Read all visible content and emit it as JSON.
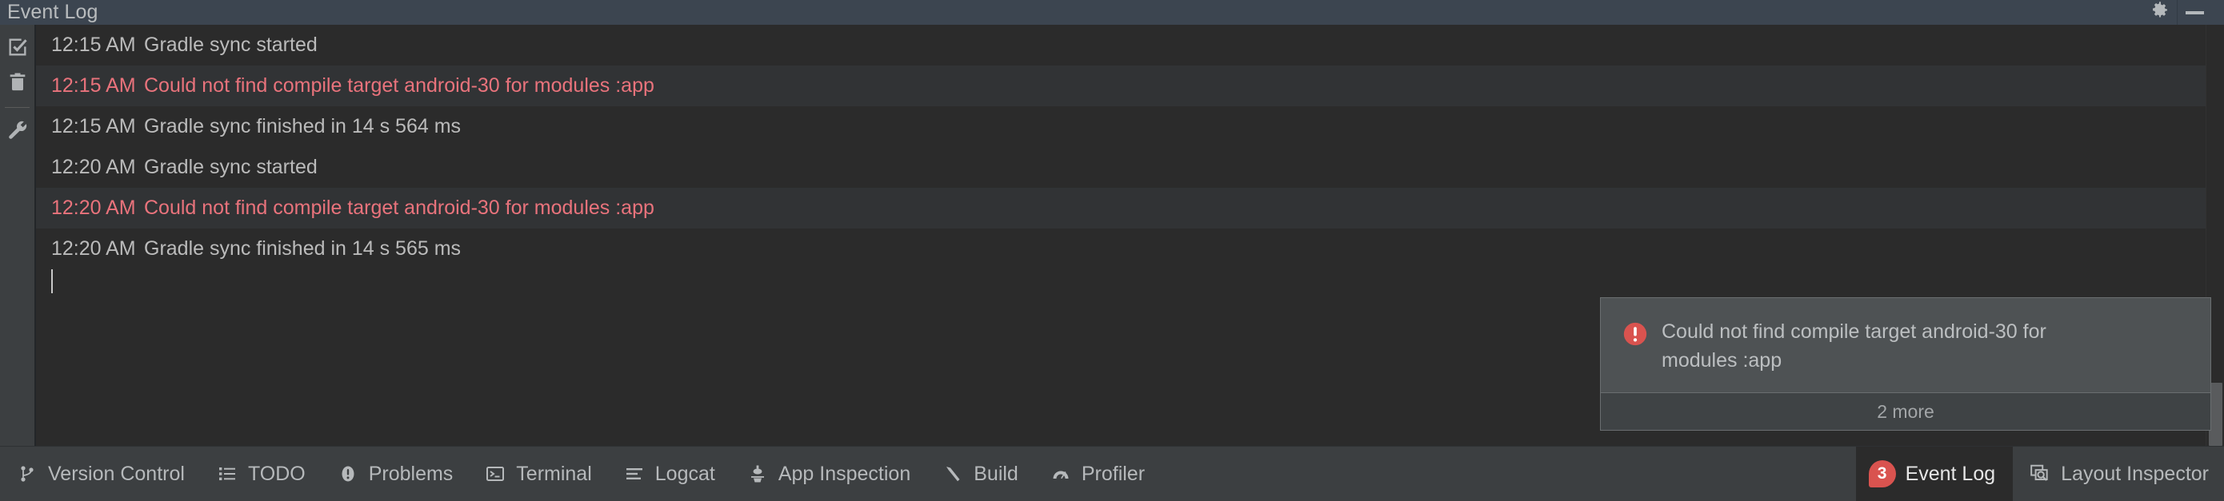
{
  "window": {
    "title": "Event Log",
    "settings_icon": "gear-icon",
    "minimize_icon": "minimize-icon"
  },
  "toolstrip": {
    "items": [
      {
        "icon": "checkbox-checked-icon",
        "label": "Mark all as read"
      },
      {
        "icon": "trash-icon",
        "label": "Clear all"
      },
      {
        "icon": "wrench-icon",
        "label": "Settings"
      }
    ]
  },
  "log": {
    "entries": [
      {
        "time": "12:15 AM",
        "message": "Gradle sync started",
        "level": "info"
      },
      {
        "time": "12:15 AM",
        "message": "Could not find compile target android-30 for modules :app",
        "level": "error"
      },
      {
        "time": "12:15 AM",
        "message": "Gradle sync finished in 14 s 564 ms",
        "level": "info"
      },
      {
        "time": "12:20 AM",
        "message": "Gradle sync started",
        "level": "info"
      },
      {
        "time": "12:20 AM",
        "message": "Could not find compile target android-30 for modules :app",
        "level": "error"
      },
      {
        "time": "12:20 AM",
        "message": "Gradle sync finished in 14 s 565 ms",
        "level": "info"
      }
    ]
  },
  "notification": {
    "icon": "error-circle-icon",
    "message": "Could not find compile target android-30 for modules :app",
    "more_label": "2 more"
  },
  "statusbar": {
    "left_items": [
      {
        "icon": "version-control-icon",
        "label": "Version Control"
      },
      {
        "icon": "todo-list-icon",
        "label": "TODO"
      },
      {
        "icon": "problems-icon",
        "label": "Problems"
      },
      {
        "icon": "terminal-icon",
        "label": "Terminal"
      },
      {
        "icon": "logcat-icon",
        "label": "Logcat"
      },
      {
        "icon": "app-inspection-icon",
        "label": "App Inspection"
      },
      {
        "icon": "build-hammer-icon",
        "label": "Build"
      },
      {
        "icon": "profiler-icon",
        "label": "Profiler"
      }
    ],
    "right_items": [
      {
        "icon": "event-log-badge",
        "label": "Event Log",
        "badge": "3",
        "active": true
      },
      {
        "icon": "layout-inspector-icon",
        "label": "Layout Inspector",
        "active": false
      }
    ]
  },
  "colors": {
    "titlebar_bg": "#3c4550",
    "panel_bg": "#2b2b2b",
    "toolstrip_bg": "#3c3f41",
    "error_text": "#e9737c",
    "error_row_bg": "#313335",
    "balloon_bg": "#4e5254",
    "badge_red": "#d9534f",
    "text": "#bbbbbb"
  }
}
